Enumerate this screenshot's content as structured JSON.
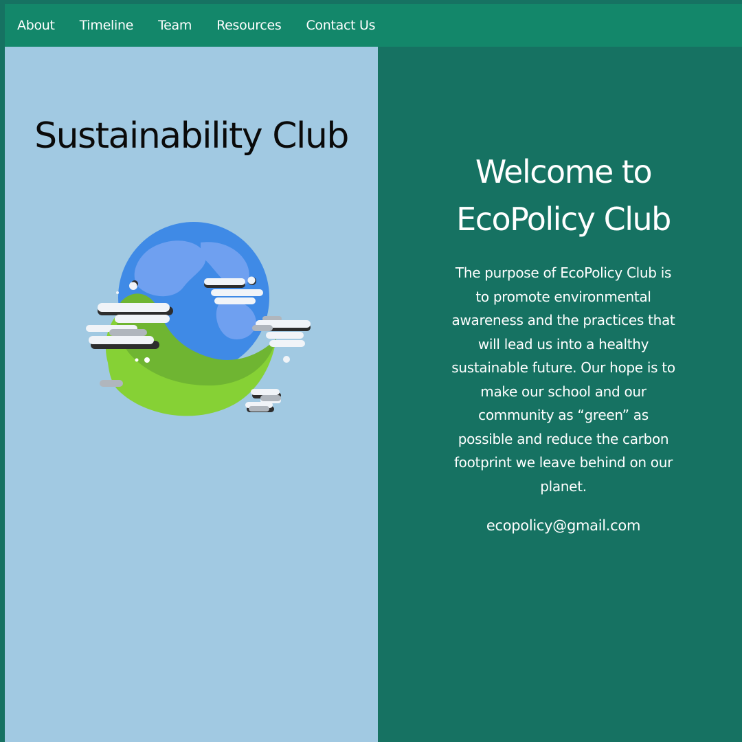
{
  "nav": {
    "items": [
      "About",
      "Timeline",
      "Team",
      "Resources",
      "Contact Us"
    ]
  },
  "left": {
    "title": "Sustainability Club",
    "illustration": "globe-with-leaf-and-clouds"
  },
  "right": {
    "heading": "Welcome to EcoPolicy Club",
    "purpose": "The purpose of EcoPolicy Club is to promote environmental awareness and the practices that will lead us into a healthy sustainable future. Our hope is to make our school and our community as “green” as possible and reduce the carbon footprint we leave behind on our planet.",
    "email": "ecopolicy@gmail.com"
  },
  "colors": {
    "page_background": "#167262",
    "navbar": "#13876a",
    "left_panel": "#a1c9e2",
    "right_panel": "#167262",
    "globe_ocean": "#3f8ae6",
    "globe_land": "#6fa0f0",
    "leaf_dark": "#6fb532",
    "leaf_light": "#86d135"
  }
}
